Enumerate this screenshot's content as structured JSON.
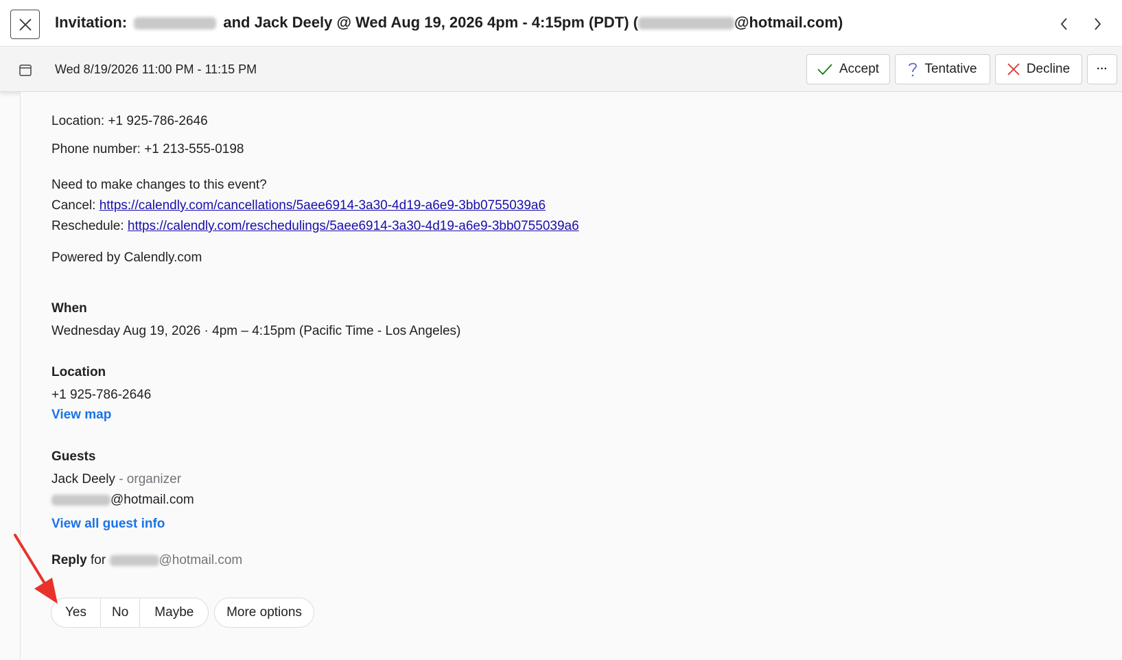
{
  "header": {
    "title_prefix": "Invitation:",
    "title_middle": "and Jack Deely @ Wed Aug 19, 2026 4pm - 4:15pm (PDT) (",
    "title_suffix": "@hotmail.com)",
    "close_icon": "close-icon",
    "prev_icon": "chevron-left-icon",
    "next_icon": "chevron-right-icon"
  },
  "event_bar": {
    "time": "Wed 8/19/2026 11:00 PM - 11:15 PM",
    "accept": "Accept",
    "tentative": "Tentative",
    "decline": "Decline",
    "more": "···",
    "accept_color": "#107c10",
    "tentative_color": "#5b5fc7",
    "decline_color": "#d13438"
  },
  "body": {
    "location_line": "Location: +1 925-786-2646",
    "phone_line": "Phone number: +1 213-555-0198",
    "changes_question": "Need to make changes to this event?",
    "cancel_label": "Cancel:",
    "cancel_url": "https://calendly.com/cancellations/5aee6914-3a30-4d19-a6e9-3bb0755039a6",
    "reschedule_label": "Reschedule:",
    "reschedule_url": "https://calendly.com/reschedulings/5aee6914-3a30-4d19-a6e9-3bb0755039a6",
    "powered_by": "Powered by Calendly.com"
  },
  "when": {
    "heading": "When",
    "value": "Wednesday Aug 19, 2026 · 4pm – 4:15pm (Pacific Time - Los Angeles)"
  },
  "location": {
    "heading": "Location",
    "value": "+1 925-786-2646",
    "view_map": "View map"
  },
  "guests": {
    "heading": "Guests",
    "organizer_name": "Jack Deely",
    "organizer_role": "- organizer",
    "guest_email_suffix": "@hotmail.com",
    "view_all": "View all guest info"
  },
  "reply": {
    "label": "Reply",
    "for": "for",
    "email_suffix": "@hotmail.com",
    "yes": "Yes",
    "no": "No",
    "maybe": "Maybe",
    "more_options": "More options"
  },
  "annotation": {
    "arrow_color": "#e8322a"
  }
}
